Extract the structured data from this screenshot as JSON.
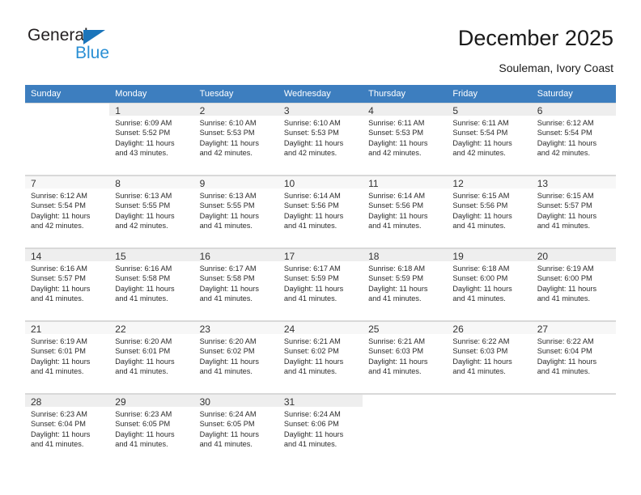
{
  "brand": {
    "name_part1": "General",
    "name_part2": "Blue",
    "triangle_color": "#1b75bb",
    "blue_color": "#2a8fd4"
  },
  "header": {
    "title": "December 2025",
    "subtitle": "Souleman, Ivory Coast",
    "header_bg": "#3d7ebf"
  },
  "weekdays": [
    "Sunday",
    "Monday",
    "Tuesday",
    "Wednesday",
    "Thursday",
    "Friday",
    "Saturday"
  ],
  "weeks": [
    [
      {
        "day": "",
        "sunrise": "",
        "sunset": "",
        "daylight1": "",
        "daylight2": ""
      },
      {
        "day": "1",
        "sunrise": "Sunrise: 6:09 AM",
        "sunset": "Sunset: 5:52 PM",
        "daylight1": "Daylight: 11 hours",
        "daylight2": "and 43 minutes."
      },
      {
        "day": "2",
        "sunrise": "Sunrise: 6:10 AM",
        "sunset": "Sunset: 5:53 PM",
        "daylight1": "Daylight: 11 hours",
        "daylight2": "and 42 minutes."
      },
      {
        "day": "3",
        "sunrise": "Sunrise: 6:10 AM",
        "sunset": "Sunset: 5:53 PM",
        "daylight1": "Daylight: 11 hours",
        "daylight2": "and 42 minutes."
      },
      {
        "day": "4",
        "sunrise": "Sunrise: 6:11 AM",
        "sunset": "Sunset: 5:53 PM",
        "daylight1": "Daylight: 11 hours",
        "daylight2": "and 42 minutes."
      },
      {
        "day": "5",
        "sunrise": "Sunrise: 6:11 AM",
        "sunset": "Sunset: 5:54 PM",
        "daylight1": "Daylight: 11 hours",
        "daylight2": "and 42 minutes."
      },
      {
        "day": "6",
        "sunrise": "Sunrise: 6:12 AM",
        "sunset": "Sunset: 5:54 PM",
        "daylight1": "Daylight: 11 hours",
        "daylight2": "and 42 minutes."
      }
    ],
    [
      {
        "day": "7",
        "sunrise": "Sunrise: 6:12 AM",
        "sunset": "Sunset: 5:54 PM",
        "daylight1": "Daylight: 11 hours",
        "daylight2": "and 42 minutes."
      },
      {
        "day": "8",
        "sunrise": "Sunrise: 6:13 AM",
        "sunset": "Sunset: 5:55 PM",
        "daylight1": "Daylight: 11 hours",
        "daylight2": "and 42 minutes."
      },
      {
        "day": "9",
        "sunrise": "Sunrise: 6:13 AM",
        "sunset": "Sunset: 5:55 PM",
        "daylight1": "Daylight: 11 hours",
        "daylight2": "and 41 minutes."
      },
      {
        "day": "10",
        "sunrise": "Sunrise: 6:14 AM",
        "sunset": "Sunset: 5:56 PM",
        "daylight1": "Daylight: 11 hours",
        "daylight2": "and 41 minutes."
      },
      {
        "day": "11",
        "sunrise": "Sunrise: 6:14 AM",
        "sunset": "Sunset: 5:56 PM",
        "daylight1": "Daylight: 11 hours",
        "daylight2": "and 41 minutes."
      },
      {
        "day": "12",
        "sunrise": "Sunrise: 6:15 AM",
        "sunset": "Sunset: 5:56 PM",
        "daylight1": "Daylight: 11 hours",
        "daylight2": "and 41 minutes."
      },
      {
        "day": "13",
        "sunrise": "Sunrise: 6:15 AM",
        "sunset": "Sunset: 5:57 PM",
        "daylight1": "Daylight: 11 hours",
        "daylight2": "and 41 minutes."
      }
    ],
    [
      {
        "day": "14",
        "sunrise": "Sunrise: 6:16 AM",
        "sunset": "Sunset: 5:57 PM",
        "daylight1": "Daylight: 11 hours",
        "daylight2": "and 41 minutes."
      },
      {
        "day": "15",
        "sunrise": "Sunrise: 6:16 AM",
        "sunset": "Sunset: 5:58 PM",
        "daylight1": "Daylight: 11 hours",
        "daylight2": "and 41 minutes."
      },
      {
        "day": "16",
        "sunrise": "Sunrise: 6:17 AM",
        "sunset": "Sunset: 5:58 PM",
        "daylight1": "Daylight: 11 hours",
        "daylight2": "and 41 minutes."
      },
      {
        "day": "17",
        "sunrise": "Sunrise: 6:17 AM",
        "sunset": "Sunset: 5:59 PM",
        "daylight1": "Daylight: 11 hours",
        "daylight2": "and 41 minutes."
      },
      {
        "day": "18",
        "sunrise": "Sunrise: 6:18 AM",
        "sunset": "Sunset: 5:59 PM",
        "daylight1": "Daylight: 11 hours",
        "daylight2": "and 41 minutes."
      },
      {
        "day": "19",
        "sunrise": "Sunrise: 6:18 AM",
        "sunset": "Sunset: 6:00 PM",
        "daylight1": "Daylight: 11 hours",
        "daylight2": "and 41 minutes."
      },
      {
        "day": "20",
        "sunrise": "Sunrise: 6:19 AM",
        "sunset": "Sunset: 6:00 PM",
        "daylight1": "Daylight: 11 hours",
        "daylight2": "and 41 minutes."
      }
    ],
    [
      {
        "day": "21",
        "sunrise": "Sunrise: 6:19 AM",
        "sunset": "Sunset: 6:01 PM",
        "daylight1": "Daylight: 11 hours",
        "daylight2": "and 41 minutes."
      },
      {
        "day": "22",
        "sunrise": "Sunrise: 6:20 AM",
        "sunset": "Sunset: 6:01 PM",
        "daylight1": "Daylight: 11 hours",
        "daylight2": "and 41 minutes."
      },
      {
        "day": "23",
        "sunrise": "Sunrise: 6:20 AM",
        "sunset": "Sunset: 6:02 PM",
        "daylight1": "Daylight: 11 hours",
        "daylight2": "and 41 minutes."
      },
      {
        "day": "24",
        "sunrise": "Sunrise: 6:21 AM",
        "sunset": "Sunset: 6:02 PM",
        "daylight1": "Daylight: 11 hours",
        "daylight2": "and 41 minutes."
      },
      {
        "day": "25",
        "sunrise": "Sunrise: 6:21 AM",
        "sunset": "Sunset: 6:03 PM",
        "daylight1": "Daylight: 11 hours",
        "daylight2": "and 41 minutes."
      },
      {
        "day": "26",
        "sunrise": "Sunrise: 6:22 AM",
        "sunset": "Sunset: 6:03 PM",
        "daylight1": "Daylight: 11 hours",
        "daylight2": "and 41 minutes."
      },
      {
        "day": "27",
        "sunrise": "Sunrise: 6:22 AM",
        "sunset": "Sunset: 6:04 PM",
        "daylight1": "Daylight: 11 hours",
        "daylight2": "and 41 minutes."
      }
    ],
    [
      {
        "day": "28",
        "sunrise": "Sunrise: 6:23 AM",
        "sunset": "Sunset: 6:04 PM",
        "daylight1": "Daylight: 11 hours",
        "daylight2": "and 41 minutes."
      },
      {
        "day": "29",
        "sunrise": "Sunrise: 6:23 AM",
        "sunset": "Sunset: 6:05 PM",
        "daylight1": "Daylight: 11 hours",
        "daylight2": "and 41 minutes."
      },
      {
        "day": "30",
        "sunrise": "Sunrise: 6:24 AM",
        "sunset": "Sunset: 6:05 PM",
        "daylight1": "Daylight: 11 hours",
        "daylight2": "and 41 minutes."
      },
      {
        "day": "31",
        "sunrise": "Sunrise: 6:24 AM",
        "sunset": "Sunset: 6:06 PM",
        "daylight1": "Daylight: 11 hours",
        "daylight2": "and 41 minutes."
      },
      {
        "day": "",
        "sunrise": "",
        "sunset": "",
        "daylight1": "",
        "daylight2": ""
      },
      {
        "day": "",
        "sunrise": "",
        "sunset": "",
        "daylight1": "",
        "daylight2": ""
      },
      {
        "day": "",
        "sunrise": "",
        "sunset": "",
        "daylight1": "",
        "daylight2": ""
      }
    ]
  ]
}
